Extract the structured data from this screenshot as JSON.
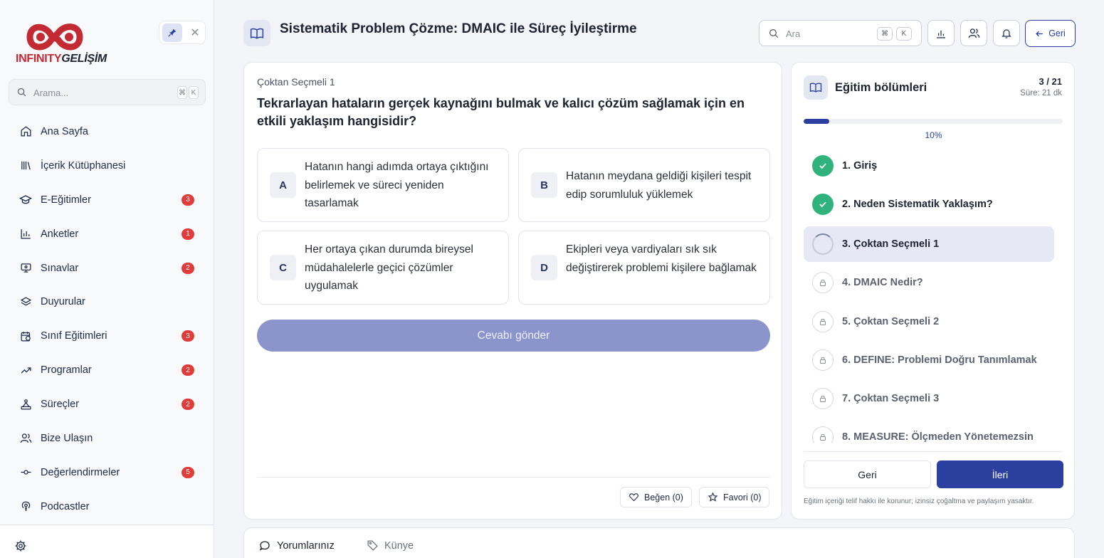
{
  "brand": {
    "name_part1": "INFINITY",
    "name_part2": "GELİŞİM"
  },
  "sidebar": {
    "search_placeholder": "Arama...",
    "shortcut": [
      "⌘",
      "K"
    ],
    "items": [
      {
        "label": "Ana Sayfa",
        "icon": "home-icon",
        "badge": ""
      },
      {
        "label": "İçerik Kütüphanesi",
        "icon": "library-icon",
        "badge": ""
      },
      {
        "label": "E-Eğitimler",
        "icon": "graduation-cap-icon",
        "badge": "3"
      },
      {
        "label": "Anketler",
        "icon": "bar-chart-icon",
        "badge": "1"
      },
      {
        "label": "Sınavlar",
        "icon": "monitor-icon",
        "badge": "2"
      },
      {
        "label": "Duyurular",
        "icon": "layers-icon",
        "badge": ""
      },
      {
        "label": "Sınıf Eğitimleri",
        "icon": "calendar-clock-icon",
        "badge": "3"
      },
      {
        "label": "Programlar",
        "icon": "trending-up-icon",
        "badge": "2"
      },
      {
        "label": "Süreçler",
        "icon": "workflow-icon",
        "badge": "2"
      },
      {
        "label": "Bize Ulaşın",
        "icon": "users-icon",
        "badge": ""
      },
      {
        "label": "Değerlendirmeler",
        "icon": "commit-icon",
        "badge": "5"
      },
      {
        "label": "Podcastler",
        "icon": "podcast-icon",
        "badge": ""
      }
    ]
  },
  "header": {
    "title": "Sistematik Problem Çözme: DMAIC ile Süreç İyileştirme",
    "search_placeholder": "Ara",
    "shortcut": [
      "⌘",
      "K"
    ],
    "back_label": "Geri"
  },
  "question": {
    "label": "Çoktan Seçmeli 1",
    "text": "Tekrarlayan hataların gerçek kaynağını bulmak ve kalıcı çözüm sağlamak için en etkili yaklaşım hangisidir?",
    "options": [
      {
        "letter": "A",
        "text": "Hatanın hangi adımda ortaya çıktığını belirlemek ve süreci yeniden tasarlamak"
      },
      {
        "letter": "B",
        "text": "Hatanın meydana geldiği kişileri tespit edip sorumluluk yüklemek"
      },
      {
        "letter": "C",
        "text": "Her ortaya çıkan durumda bireysel müdahalelerle geçici çözümler uygulamak"
      },
      {
        "letter": "D",
        "text": "Ekipleri veya vardiyaları sık sık değiştirerek problemi kişilere bağlamak"
      }
    ],
    "submit_label": "Cevabı gönder",
    "like_label": "Beğen (0)",
    "favorite_label": "Favori (0)"
  },
  "sections": {
    "title": "Eğitim bölümleri",
    "count": "3 / 21",
    "duration": "Süre: 21 dk",
    "progress_percent": 10,
    "progress_label": "10%",
    "items": [
      {
        "label": "1. Giriş",
        "status": "done"
      },
      {
        "label": "2. Neden Sistematik Yaklaşım?",
        "status": "done"
      },
      {
        "label": "3. Çoktan Seçmeli 1",
        "status": "current"
      },
      {
        "label": "4. DMAIC Nedir?",
        "status": "locked"
      },
      {
        "label": "5. Çoktan Seçmeli 2",
        "status": "locked"
      },
      {
        "label": "6. DEFINE: Problemi Doğru Tanımlamak",
        "status": "locked"
      },
      {
        "label": "7. Çoktan Seçmeli 3",
        "status": "locked"
      },
      {
        "label": "8. MEASURE: Ölçmeden Yönetemezsin",
        "status": "locked"
      }
    ],
    "back_label": "Geri",
    "next_label": "İleri",
    "copyright": "Eğitim içeriği telif hakkı ile korunur; izinsiz çoğaltma ve paylaşım yasaktır."
  },
  "bottom_tabs": [
    {
      "label": "Yorumlarınız",
      "icon": "comment-icon",
      "active": true
    },
    {
      "label": "Künye",
      "icon": "tag-icon",
      "active": false
    }
  ],
  "colors": {
    "accent": "#2a3f9e",
    "success": "#2fb27b",
    "badge": "#e03c3c",
    "brand_red": "#c42a34"
  }
}
